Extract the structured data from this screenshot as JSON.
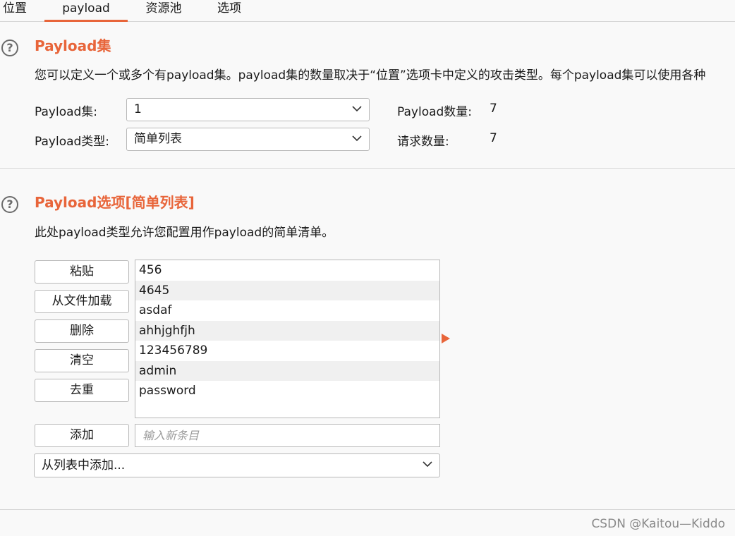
{
  "tabs": [
    {
      "label": "位置"
    },
    {
      "label": "payload"
    },
    {
      "label": "资源池"
    },
    {
      "label": "选项"
    }
  ],
  "payload_sets": {
    "title": "Payload集",
    "description": "您可以定义一个或多个有payload集。payload集的数量取决于“位置”选项卡中定义的攻击类型。每个payload集可以使用各种",
    "set_label": "Payload集:",
    "set_value": "1",
    "type_label": "Payload类型:",
    "type_value": "简单列表",
    "count_label": "Payload数量:",
    "count_value": "7",
    "request_label": "请求数量:",
    "request_value": "7"
  },
  "payload_options": {
    "title": "Payload选项[简单列表]",
    "description": "此处payload类型允许您配置用作payload的简单清单。",
    "buttons": {
      "paste": "粘贴",
      "load": "从文件加载",
      "remove": "删除",
      "clear": "清空",
      "dedupe": "去重",
      "add": "添加"
    },
    "items": [
      "456",
      "4645",
      "asdaf",
      "ahhjghfjh",
      "123456789",
      "admin",
      "password"
    ],
    "new_item_placeholder": "输入新条目",
    "add_from_list": "从列表中添加..."
  },
  "watermark": "CSDN @Kaitou—Kiddo",
  "colors": {
    "accent": "#e8653a",
    "background": "#f9f9f9",
    "border": "#b8b8b8"
  },
  "icons": {
    "help": "help-icon",
    "chevron": "chevron-down-icon",
    "arrow": "arrow-right-icon"
  }
}
